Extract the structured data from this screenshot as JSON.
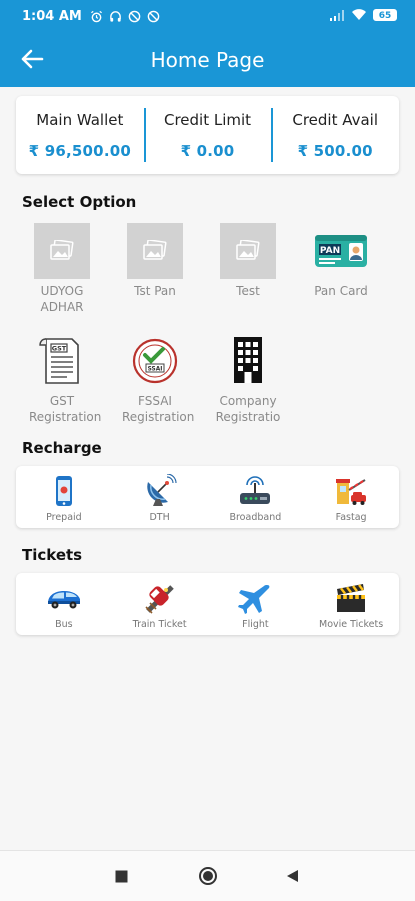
{
  "status_bar": {
    "time": "1:04 AM",
    "battery": "65"
  },
  "header": {
    "title": "Home Page"
  },
  "wallet": [
    {
      "label": "Main Wallet",
      "value": "₹ 96,500.00"
    },
    {
      "label": "Credit Limit",
      "value": "₹ 0.00"
    },
    {
      "label": "Credit Avail",
      "value": "₹ 500.00"
    }
  ],
  "select_option": {
    "title": "Select Option",
    "items": [
      {
        "label": "UDYOG ADHAR",
        "icon": "image-placeholder-icon"
      },
      {
        "label": "Tst Pan",
        "icon": "image-placeholder-icon"
      },
      {
        "label": "Test",
        "icon": "image-placeholder-icon"
      },
      {
        "label": "Pan Card",
        "icon": "pan-card-icon"
      },
      {
        "label": "GST Registration",
        "icon": "gst-document-icon"
      },
      {
        "label": "FSSAI Registration",
        "icon": "fssai-badge-icon"
      },
      {
        "label": "Company Registratio",
        "icon": "building-icon"
      }
    ],
    "pan_badge_text": "PAN",
    "gst_badge_text": "GST",
    "fssai_badge_text": "SSAI"
  },
  "recharge": {
    "title": "Recharge",
    "items": [
      {
        "label": "Prepaid",
        "icon": "mobile-phone-icon"
      },
      {
        "label": "DTH",
        "icon": "satellite-dish-icon"
      },
      {
        "label": "Broadband",
        "icon": "router-icon"
      },
      {
        "label": "Fastag",
        "icon": "toll-booth-icon"
      }
    ]
  },
  "tickets": {
    "title": "Tickets",
    "items": [
      {
        "label": "Bus",
        "icon": "bus-icon"
      },
      {
        "label": "Train Ticket",
        "icon": "train-icon"
      },
      {
        "label": "Flight",
        "icon": "airplane-icon"
      },
      {
        "label": "Movie Tickets",
        "icon": "clapperboard-icon"
      }
    ]
  },
  "colors": {
    "primary": "#1a96d6",
    "accent_text": "#1a8fcf"
  }
}
